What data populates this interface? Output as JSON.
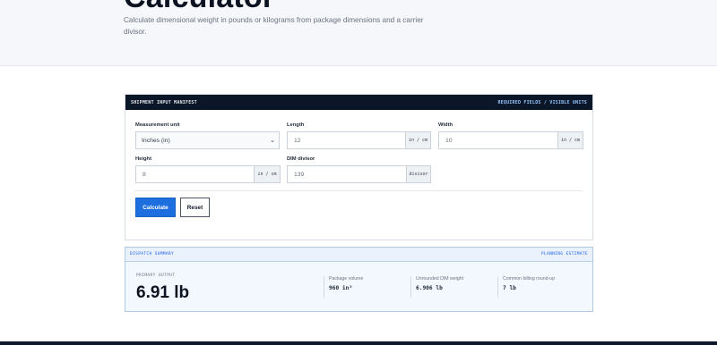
{
  "page": {
    "title": "Calculator",
    "subtitle": "Calculate dimensional weight in pounds or kilograms from package dimensions and a carrier divisor."
  },
  "form_card": {
    "header_left": "SHIPMENT INPUT MANIFEST",
    "header_right": "REQUIRED FIELDS / VISIBLE UNITS",
    "measurement_unit": {
      "label": "Measurement unit",
      "value": "Inches (in)"
    },
    "length": {
      "label": "Length",
      "value": "12",
      "unit": "in / cm"
    },
    "width": {
      "label": "Width",
      "value": "10",
      "unit": "in / cm"
    },
    "height": {
      "label": "Height",
      "value": "8",
      "unit": "in / cm"
    },
    "dim_divisor": {
      "label": "DIM divisor",
      "value": "139",
      "unit": "divisor"
    },
    "calculate_label": "Calculate",
    "reset_label": "Reset"
  },
  "summary": {
    "header_left": "DISPATCH SUMMARY",
    "header_right": "PLANNING ESTIMATE",
    "primary_label": "PRIMARY OUTPUT",
    "primary_value": "6.91 lb",
    "metrics": [
      {
        "label": "Package volume",
        "value": "960 in³"
      },
      {
        "label": "Unrounded DIM weight",
        "value": "6.906 lb"
      },
      {
        "label": "Common billing round-up",
        "value": "7 lb"
      }
    ]
  },
  "colors": {
    "header_bg": "#0b1628",
    "primary_button": "#1d6fe0",
    "summary_bg": "#f3f8fe"
  }
}
